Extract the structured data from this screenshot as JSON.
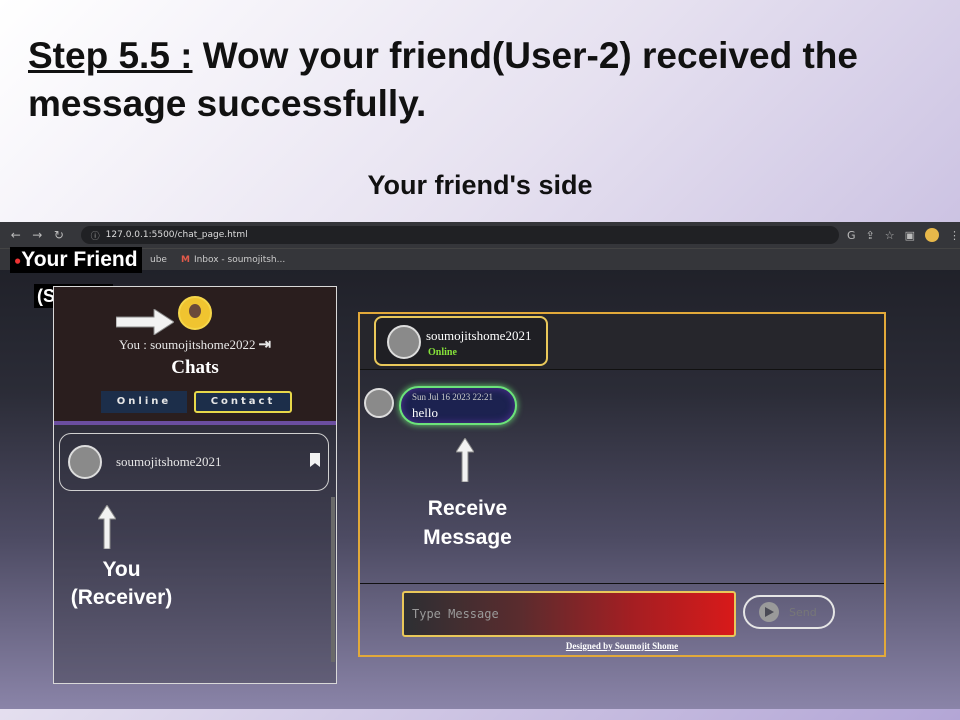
{
  "slide": {
    "title_step": "Step 5.5 :",
    "title_rest": "Wow your friend(User-2) received the message successfully.",
    "subtitle": "Your friend's side"
  },
  "browser": {
    "url": "127.0.0.1:5500/chat_page.html",
    "bookmarks": [
      "ube",
      "Inbox - soumojitsh..."
    ],
    "nav_icons": [
      "back-icon",
      "forward-icon",
      "reload-icon"
    ]
  },
  "annotations": {
    "your_friend": "Your Friend",
    "sender": "(Sender)",
    "you": "You",
    "receiver": "(Receiver)",
    "receive_message_line1": "Receive",
    "receive_message_line2": "Message"
  },
  "left_panel": {
    "you_label": "You : soumojitshome2022",
    "logout_glyph": "⇥",
    "chats_title": "Chats",
    "tabs": [
      {
        "label": "Online"
      },
      {
        "label": "Contact",
        "active": true
      }
    ],
    "contacts": [
      {
        "name": "soumojitshome2021"
      }
    ]
  },
  "right_panel": {
    "header": {
      "name": "soumojitshome2021",
      "status": "Online"
    },
    "messages": [
      {
        "time": "Sun Jul 16 2023 22:21",
        "text": "hello"
      }
    ],
    "input_placeholder": "Type Message",
    "send_label": "Send",
    "footer": "Designed by Soumojit Shome"
  },
  "colors": {
    "accent_gold": "#e2a93a",
    "online_green": "#86e23a",
    "tab_bg": "#1c2e4a",
    "input_red": "#d81a1a"
  }
}
